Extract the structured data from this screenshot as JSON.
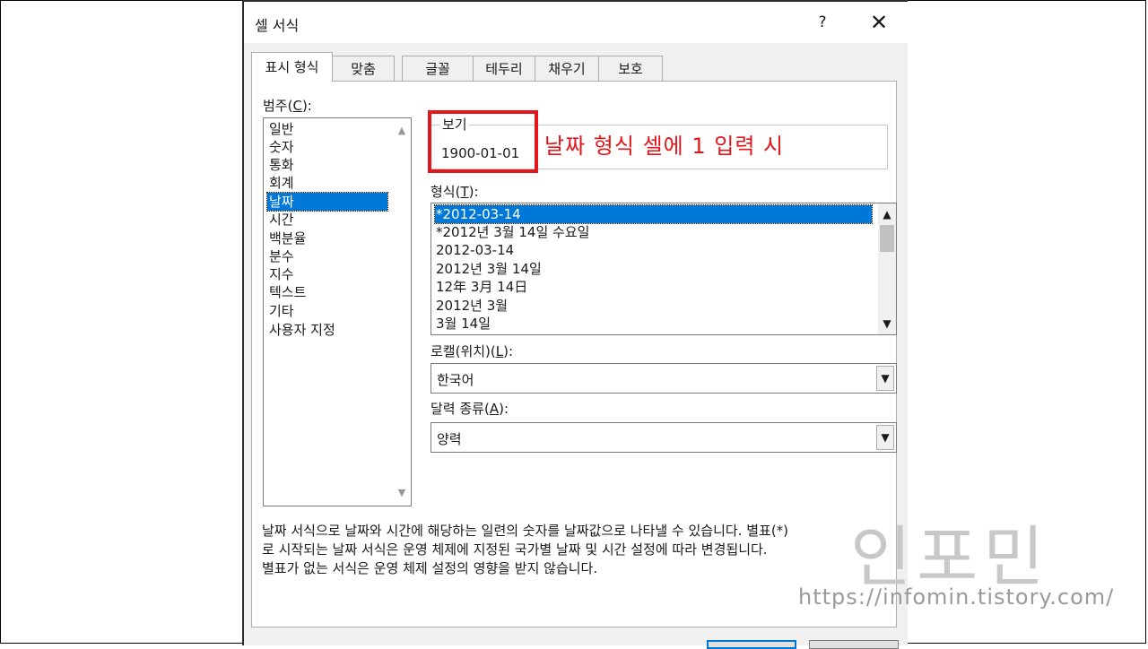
{
  "dialog": {
    "title": "셀 서식",
    "help_label": "?",
    "close_label": "✕"
  },
  "tabs": [
    {
      "label": "표시 형식",
      "active": true
    },
    {
      "label": "맞춤"
    },
    {
      "label": "글꼴"
    },
    {
      "label": "테두리"
    },
    {
      "label": "채우기"
    },
    {
      "label": "보호"
    }
  ],
  "category": {
    "label": "범주(",
    "mnemonic": "C",
    "label_end": "):",
    "items": [
      "일반",
      "숫자",
      "통화",
      "회계",
      "날짜",
      "시간",
      "백분율",
      "분수",
      "지수",
      "텍스트",
      "기타",
      "사용자 지정"
    ],
    "selected": "날짜"
  },
  "preview": {
    "label": "보기",
    "value": "1900-01-01"
  },
  "annotation": "날짜 형식 셀에 1 입력 시",
  "format": {
    "label": "형식(",
    "mnemonic": "T",
    "label_end": "):",
    "items": [
      "*2012-03-14",
      "*2012년 3월 14일 수요일",
      "2012-03-14",
      "2012년 3월 14일",
      "12年 3月 14日",
      "2012년 3월",
      "3월 14일"
    ],
    "selected": "*2012-03-14"
  },
  "locale": {
    "label": "로캘(위치)(",
    "mnemonic": "L",
    "label_end": "):",
    "value": "한국어"
  },
  "calendar": {
    "label": "달력 종류(",
    "mnemonic": "A",
    "label_end": "):",
    "value": "양력"
  },
  "description": [
    "날짜 서식으로 날짜와 시간에 해당하는 일련의 숫자를 날짜값으로 나타낼 수 있습니다. 별표(*)",
    "로 시작되는 날짜 서식은 운영 체제에 지정된 국가별 날짜 및 시간 설정에 따라 변경됩니다.",
    "별표가 없는 서식은 운영 체제 설정의 영향을 받지 않습니다."
  ],
  "watermark": {
    "name": "인포민",
    "url": "https://infomin.tistory.com/"
  },
  "icons": {
    "scroll_up": "chevron-up-icon",
    "scroll_down": "chevron-down-icon",
    "dropdown": "chevron-down-icon"
  },
  "colors": {
    "selection": "#0078d7",
    "annotation": "#e3161c",
    "dialog_bg": "#f0f0f0"
  }
}
